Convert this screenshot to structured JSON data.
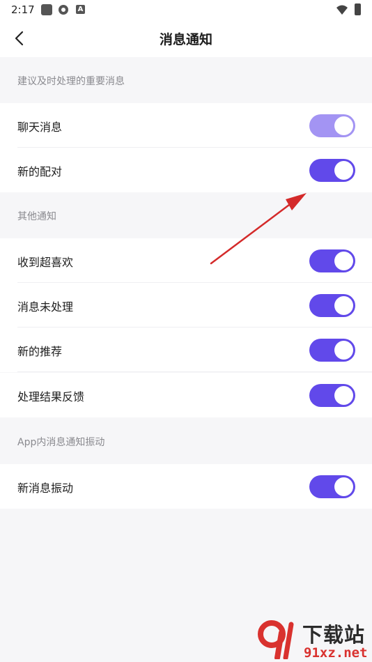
{
  "status_bar": {
    "time": "2:17"
  },
  "header": {
    "title": "消息通知"
  },
  "sections": [
    {
      "label": "建议及时处理的重要消息",
      "items": [
        {
          "label": "聊天消息",
          "enabled": true
        },
        {
          "label": "新的配对",
          "enabled": true
        }
      ]
    },
    {
      "label": "其他通知",
      "items": [
        {
          "label": "收到超喜欢",
          "enabled": true
        },
        {
          "label": "消息未处理",
          "enabled": true
        },
        {
          "label": "新的推荐",
          "enabled": true
        },
        {
          "label": "处理结果反馈",
          "enabled": true
        }
      ]
    },
    {
      "label": "App内消息通知振动",
      "items": [
        {
          "label": "新消息振动",
          "enabled": true
        }
      ]
    }
  ],
  "colors": {
    "toggle_on": "#6149ea",
    "toggle_pressed": "#a394f3",
    "annotation_arrow": "#d42a2a"
  },
  "watermark": {
    "brand": "下载站",
    "url": "91xz.net"
  }
}
